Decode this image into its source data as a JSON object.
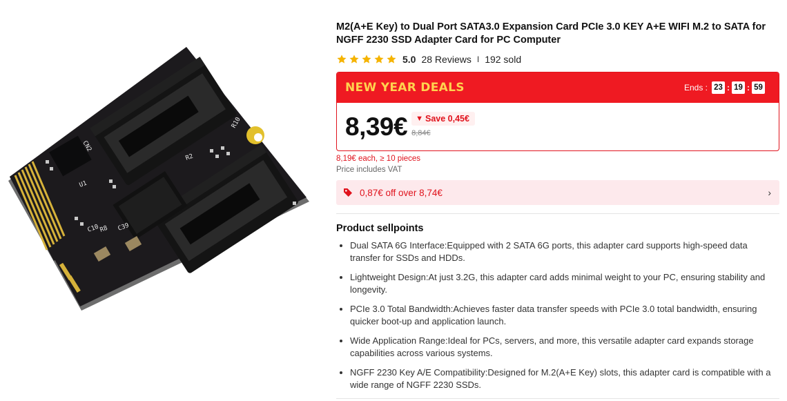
{
  "product": {
    "title": "M2(A+E Key) to Dual Port SATA3.0 Expansion Card PCIe 3.0 KEY A+E WIFI M.2 to SATA for NGFF 2230 SSD Adapter Card for PC Computer",
    "rating": "5.0",
    "rating_stars": 5,
    "reviews": "28 Reviews",
    "separator": "I",
    "sold": "192 sold",
    "image_icon": "product-photo"
  },
  "deal": {
    "label": "NEW YEAR DEALS",
    "ends_label": "Ends :",
    "hours": "23",
    "minutes": "19",
    "seconds": "59",
    "price": "8,39€",
    "save": "Save 0,45€",
    "old_price": "8,84€",
    "accent_color": "#ef1a22",
    "label_color": "#ffd34f"
  },
  "pricing": {
    "bulk": "8,19€ each, ≥ 10 pieces",
    "vat": "Price includes VAT"
  },
  "coupon": {
    "label": "0,87€ off over 8,74€",
    "icon": "tag-icon"
  },
  "sellpoints": {
    "title": "Product sellpoints",
    "items": [
      "Dual SATA 6G Interface:Equipped with 2 SATA 6G ports, this adapter card supports high-speed data transfer for SSDs and HDDs.",
      "Lightweight Design:At just 3.2G, this adapter card adds minimal weight to your PC, ensuring stability and longevity.",
      "PCIe 3.0 Total Bandwidth:Achieves faster data transfer speeds with PCIe 3.0 total bandwidth, ensuring quicker boot-up and application launch.",
      "Wide Application Range:Ideal for PCs, servers, and more, this versatile adapter card expands storage capabilities across various systems.",
      "NGFF 2230 Key A/E Compatibility:Designed for M.2(A+E Key) slots, this adapter card is compatible with a wide range of NGFF 2230 SSDs."
    ]
  }
}
